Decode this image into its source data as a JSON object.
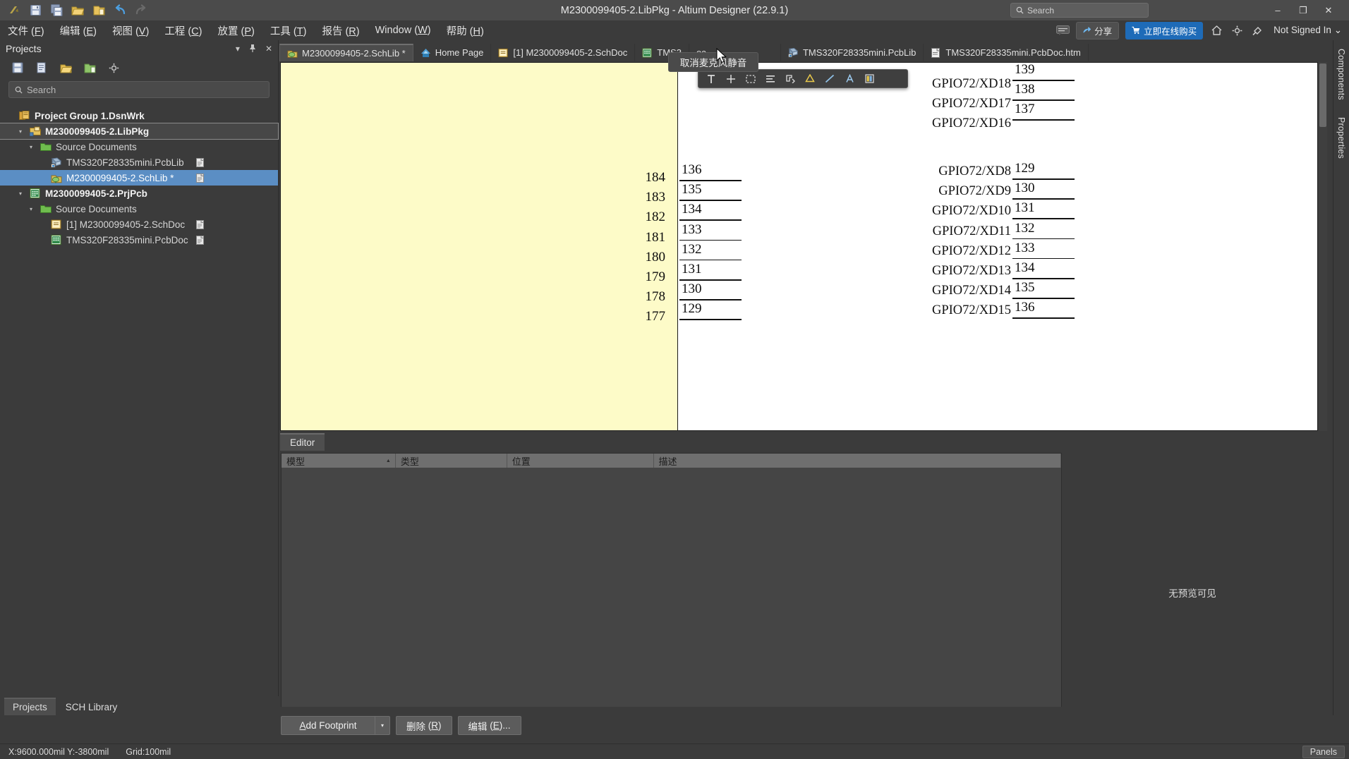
{
  "window": {
    "title": "M2300099405-2.LibPkg - Altium Designer (22.9.1)",
    "minimize": "–",
    "maximize": "❐",
    "close": "✕"
  },
  "search": {
    "placeholder": "Search",
    "icon": "search-icon"
  },
  "quick_access": [
    {
      "name": "altium-logo-icon",
      "glyph": "A"
    },
    {
      "name": "save-icon",
      "glyph": "💾"
    },
    {
      "name": "save-all-icon",
      "glyph": "💾"
    },
    {
      "name": "open-folder-icon",
      "glyph": "📂"
    },
    {
      "name": "open-project-icon",
      "glyph": "🗂"
    },
    {
      "name": "undo-icon",
      "glyph": "↶"
    },
    {
      "name": "redo-icon",
      "glyph": "↷"
    }
  ],
  "menu": [
    {
      "label": "文件",
      "mnemonic": "F"
    },
    {
      "label": "编辑",
      "mnemonic": "E"
    },
    {
      "label": "视图",
      "mnemonic": "V"
    },
    {
      "label": "工程",
      "mnemonic": "C"
    },
    {
      "label": "放置",
      "mnemonic": "P"
    },
    {
      "label": "工具",
      "mnemonic": "T"
    },
    {
      "label": "报告",
      "mnemonic": "R"
    },
    {
      "label": "Window",
      "mnemonic": "W"
    },
    {
      "label": "帮助",
      "mnemonic": "H"
    }
  ],
  "menu_right": {
    "notification_icon": "comment-icon",
    "share_label": "分享",
    "share_icon": "share-arrow-icon",
    "buy_label": "立即在线购买",
    "buy_icon": "cart-icon",
    "home_icon": "home-icon",
    "settings_icon": "gear-icon",
    "extensions_icon": "plug-icon",
    "signin_label": "Not Signed In",
    "signin_caret": "⌄"
  },
  "projects_panel": {
    "title": "Projects",
    "header_icons": [
      {
        "name": "panel-dropdown-icon",
        "glyph": "▾"
      },
      {
        "name": "panel-pin-icon",
        "glyph": "⚓"
      },
      {
        "name": "panel-close-icon",
        "glyph": "✕"
      }
    ],
    "toolbar_icons": [
      {
        "name": "save-project-icon",
        "glyph": "💾"
      },
      {
        "name": "compile-icon",
        "glyph": "📘"
      },
      {
        "name": "open-project-icon",
        "glyph": "📂"
      },
      {
        "name": "add-document-icon",
        "glyph": "📁"
      },
      {
        "name": "project-options-icon",
        "glyph": "⚙"
      }
    ],
    "search": {
      "placeholder": "Search",
      "icon": "search-icon"
    },
    "tree": [
      {
        "label": "Project Group 1.DsnWrk",
        "indent": 0,
        "bold": true,
        "twisty": "",
        "icon": "workspace-icon",
        "state": "normal",
        "doc_badge": false
      },
      {
        "label": "M2300099405-2.LibPkg",
        "indent": 1,
        "bold": true,
        "twisty": "▴",
        "icon": "libpkg-icon",
        "state": "outlined",
        "doc_badge": false
      },
      {
        "label": "Source Documents",
        "indent": 2,
        "bold": false,
        "twisty": "▴",
        "icon": "folder-icon",
        "state": "normal",
        "doc_badge": false
      },
      {
        "label": "TMS320F28335mini.PcbLib",
        "indent": 3,
        "bold": false,
        "twisty": "",
        "icon": "pcblib-icon",
        "state": "normal",
        "doc_badge": true
      },
      {
        "label": "M2300099405-2.SchLib *",
        "indent": 3,
        "bold": false,
        "twisty": "",
        "icon": "schlib-icon",
        "state": "selected",
        "doc_badge": true
      },
      {
        "label": "M2300099405-2.PrjPcb",
        "indent": 1,
        "bold": true,
        "twisty": "▴",
        "icon": "prjpcb-icon",
        "state": "normal",
        "doc_badge": false
      },
      {
        "label": "Source Documents",
        "indent": 2,
        "bold": false,
        "twisty": "▴",
        "icon": "folder-icon",
        "state": "normal",
        "doc_badge": false
      },
      {
        "label": "[1] M2300099405-2.SchDoc",
        "indent": 3,
        "bold": false,
        "twisty": "",
        "icon": "schdoc-icon",
        "state": "normal",
        "doc_badge": true
      },
      {
        "label": "TMS320F28335mini.PcbDoc",
        "indent": 3,
        "bold": false,
        "twisty": "",
        "icon": "pcbdoc-icon",
        "state": "normal",
        "doc_badge": true
      }
    ],
    "tabs": [
      {
        "label": "Projects",
        "active": true
      },
      {
        "label": "SCH Library",
        "active": false
      }
    ]
  },
  "document_tabs": [
    {
      "label": "M2300099405-2.SchLib *",
      "icon": "schlib-icon",
      "active": true
    },
    {
      "label": "Home Page",
      "icon": "home-page-icon",
      "active": false
    },
    {
      "label": "[1] M2300099405-2.SchDoc",
      "icon": "schdoc-icon",
      "active": false
    },
    {
      "label": "TMS3",
      "icon": "pcbdoc-icon",
      "active": false
    },
    {
      "label": "oc",
      "icon": "",
      "active": false
    },
    {
      "label": "TMS320F28335mini.PcbLib",
      "icon": "pcblib-icon",
      "active": false
    },
    {
      "label": "TMS320F28335mini.PcbDoc.htm",
      "icon": "html-doc-icon",
      "active": false
    }
  ],
  "tooltip": {
    "text": "取消麦克风静音"
  },
  "floating_toolbar": [
    {
      "name": "text-tool-icon",
      "glyph": "T"
    },
    {
      "name": "crosshair-tool-icon",
      "glyph": "＋"
    },
    {
      "name": "select-region-icon",
      "glyph": "⬚"
    },
    {
      "name": "align-icon",
      "glyph": "☰"
    },
    {
      "name": "measure-icon",
      "glyph": "↙"
    },
    {
      "name": "highlighter-icon",
      "glyph": "△"
    },
    {
      "name": "line-tool-icon",
      "glyph": "╱"
    },
    {
      "name": "annotate-text-icon",
      "glyph": "A"
    },
    {
      "name": "color-picker-icon",
      "glyph": "▤"
    }
  ],
  "schematic": {
    "left_pin_numbers": [
      "184",
      "183",
      "182",
      "181",
      "180",
      "179",
      "178",
      "177"
    ],
    "left_pin_labels": [
      "136",
      "135",
      "134",
      "133",
      "132",
      "131",
      "130",
      "129"
    ],
    "right_top_labels": [
      "139",
      "138",
      "137"
    ],
    "right_top_names": [
      "",
      "GPIO72/XD18",
      "GPIO72/XD17",
      "GPIO72/XD16"
    ],
    "right_group": [
      {
        "name": "GPIO72/XD8",
        "num": "129"
      },
      {
        "name": "GPIO72/XD9",
        "num": "130"
      },
      {
        "name": "GPIO72/XD10",
        "num": "131"
      },
      {
        "name": "GPIO72/XD11",
        "num": "132"
      },
      {
        "name": "GPIO72/XD12",
        "num": "133"
      },
      {
        "name": "GPIO72/XD13",
        "num": "134"
      },
      {
        "name": "GPIO72/XD14",
        "num": "135"
      },
      {
        "name": "GPIO72/XD15",
        "num": "136"
      }
    ],
    "right_top_group": [
      {
        "name": "",
        "num": "139"
      },
      {
        "name": "GPIO72/XD18",
        "num": "138"
      },
      {
        "name": "GPIO72/XD17",
        "num": "137"
      },
      {
        "name": "GPIO72/XD16",
        "num": ""
      }
    ]
  },
  "editor_strip": {
    "tab_label": "Editor"
  },
  "model_panel": {
    "columns": [
      "模型",
      "类型",
      "位置",
      "描述"
    ],
    "rows": [],
    "no_preview": "无预览可见"
  },
  "footer_buttons": {
    "add_footprint": {
      "label": "Add Footprint",
      "mnemonic": "A",
      "dropdown": "▾"
    },
    "delete": {
      "label": "删除",
      "mnemonic": "R"
    },
    "edit": {
      "label": "编辑",
      "mnemonic": "E",
      "suffix": "..."
    }
  },
  "right_edge_tabs": [
    {
      "label": "Components"
    },
    {
      "label": "Properties"
    }
  ],
  "status_bar": {
    "coordinates": "X:9600.000mil Y:-3800mil",
    "grid": "Grid:100mil",
    "panels_button": "Panels"
  }
}
